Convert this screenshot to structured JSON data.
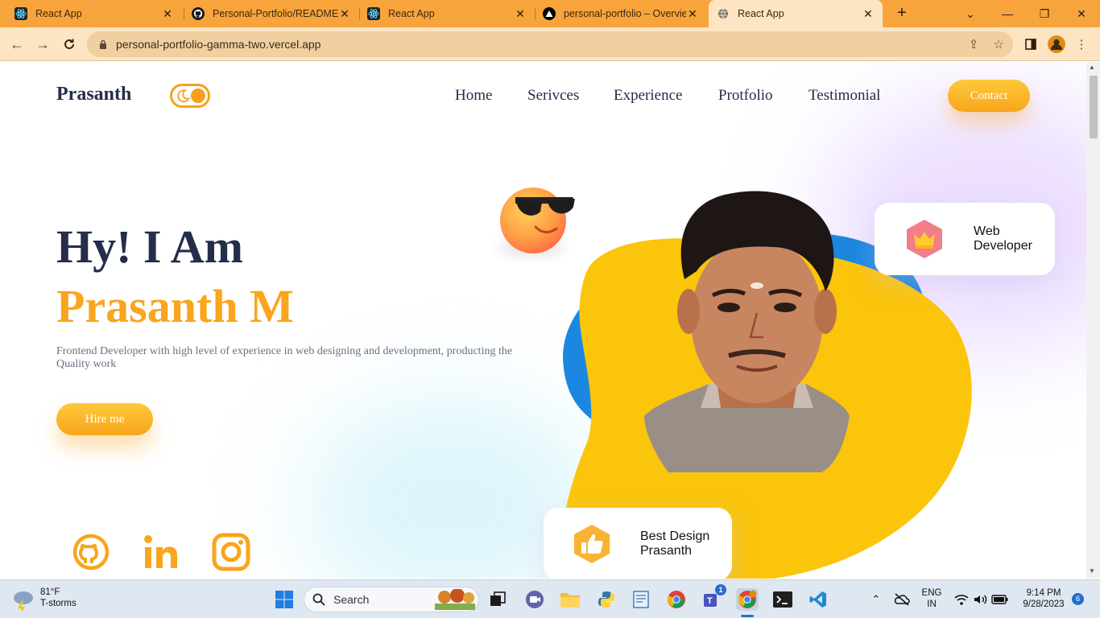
{
  "browser": {
    "tabs": [
      {
        "title": "React App",
        "icon": "react-icon",
        "active": false
      },
      {
        "title": "Personal-Portfolio/README.",
        "icon": "github-icon",
        "active": false
      },
      {
        "title": "React App",
        "icon": "react-icon",
        "active": false
      },
      {
        "title": "personal-portfolio – Overvie",
        "icon": "vercel-icon",
        "active": false
      },
      {
        "title": "React App",
        "icon": "globe-icon",
        "active": true
      }
    ],
    "url": "personal-portfolio-gamma-two.vercel.app",
    "accent": "#f8a43d"
  },
  "site": {
    "brand": "Prasanth",
    "nav": [
      "Home",
      "Serivces",
      "Experience",
      "Protfolio",
      "Testimonial"
    ],
    "contact_label": "Contact",
    "hero_line1": "Hy! I Am",
    "hero_line2": "Prasanth M",
    "description": "Frontend Developer with high level of experience in web designing and development, producting the Quality work",
    "hire_label": "Hire me",
    "socials": [
      "github-icon",
      "linkedin-icon",
      "instagram-icon"
    ],
    "card_web_line1": "Web",
    "card_web_line2": "Developer",
    "card_design_line1": "Best Design",
    "card_design_line2": "Prasanth",
    "colors": {
      "primary": "#242d49",
      "accent": "#f9a51d",
      "blob_yellow": "#fbc50c",
      "blob_blue": "#1c87e0"
    }
  },
  "taskbar": {
    "weather_temp": "81°F",
    "weather_desc": "T-storms",
    "search_placeholder": "Search",
    "lang_line1": "ENG",
    "lang_line2": "IN",
    "time": "9:14 PM",
    "date": "9/28/2023",
    "notification_count": "6",
    "teams_badge": "1"
  }
}
